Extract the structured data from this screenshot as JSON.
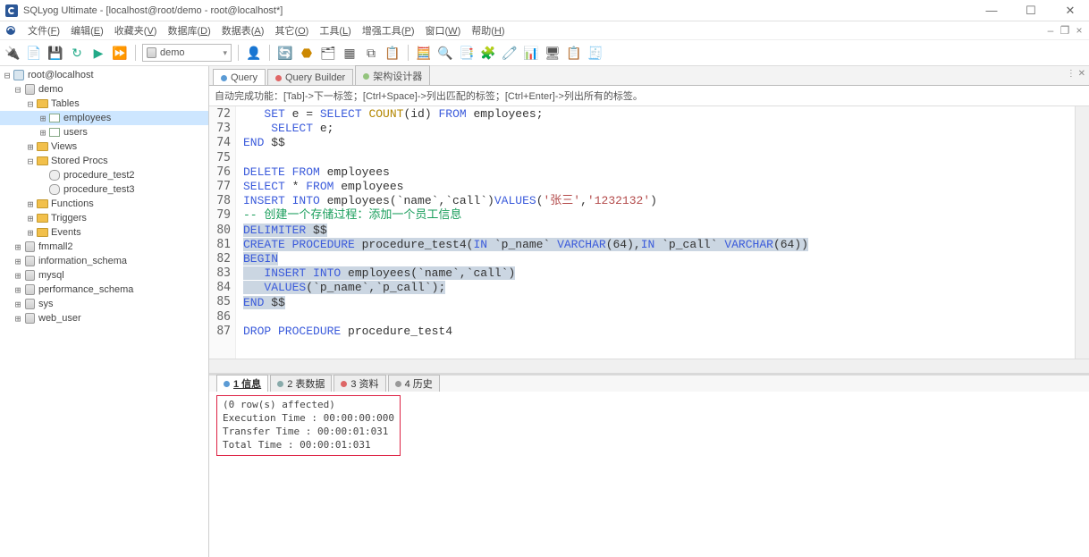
{
  "title": "SQLyog Ultimate - [localhost@root/demo - root@localhost*]",
  "menus": {
    "file": {
      "label": "文件",
      "key": "F"
    },
    "edit": {
      "label": "编辑",
      "key": "E"
    },
    "fav": {
      "label": "收藏夹",
      "key": "V"
    },
    "db": {
      "label": "数据库",
      "key": "D"
    },
    "table": {
      "label": "数据表",
      "key": "A"
    },
    "other": {
      "label": "其它",
      "key": "O"
    },
    "tools": {
      "label": "工具",
      "key": "L"
    },
    "ptools": {
      "label": "增强工具",
      "key": "P"
    },
    "window": {
      "label": "窗口",
      "key": "W"
    },
    "help": {
      "label": "帮助",
      "key": "H"
    }
  },
  "toolbar": {
    "db_selected": "demo"
  },
  "tree": {
    "root": "root@localhost",
    "db": "demo",
    "tables_label": "Tables",
    "tables": [
      "employees",
      "users"
    ],
    "views": "Views",
    "storedprocs_label": "Stored Procs",
    "storedprocs": [
      "procedure_test2",
      "procedure_test3"
    ],
    "functions": "Functions",
    "triggers": "Triggers",
    "events": "Events",
    "other_dbs": [
      "fmmall2",
      "information_schema",
      "mysql",
      "performance_schema",
      "sys",
      "web_user"
    ]
  },
  "query_tabs": {
    "query": "Query",
    "builder": "Query Builder",
    "schema": "架构设计器"
  },
  "hint": "自动完成功能：[Tab]->下一标签；[Ctrl+Space]->列出匹配的标签；[Ctrl+Enter]->列出所有的标签。",
  "editor": {
    "first_line": 72,
    "lines": [
      [
        [
          "kw",
          "   SET"
        ],
        [
          "pl",
          " e = "
        ],
        [
          "kw",
          "SELECT "
        ],
        [
          "func",
          "COUNT"
        ],
        [
          "pl",
          "(id) "
        ],
        [
          "kw",
          "FROM"
        ],
        [
          "pl",
          " employees;"
        ]
      ],
      [
        [
          "pl",
          "    "
        ],
        [
          "kw",
          "SELECT"
        ],
        [
          "pl",
          " e;"
        ]
      ],
      [
        [
          "kw",
          "END"
        ],
        [
          "pl",
          " $$"
        ]
      ],
      [
        [
          "pl",
          ""
        ]
      ],
      [
        [
          "kw",
          "DELETE FROM"
        ],
        [
          "pl",
          " employees"
        ]
      ],
      [
        [
          "kw",
          "SELECT"
        ],
        [
          "pl",
          " * "
        ],
        [
          "kw",
          "FROM"
        ],
        [
          "pl",
          " employees"
        ]
      ],
      [
        [
          "kw",
          "INSERT INTO"
        ],
        [
          "pl",
          " employees(`name`,`call`)"
        ],
        [
          "kw",
          "VALUES"
        ],
        [
          "pl",
          "("
        ],
        [
          "str",
          "'张三'"
        ],
        [
          "pl",
          ","
        ],
        [
          "str",
          "'1232132'"
        ],
        [
          "pl",
          ")"
        ]
      ],
      [
        [
          "cmt",
          "-- 创建一个存储过程：添加一个员工信息"
        ]
      ],
      [
        [
          "sel-kw",
          "DELIMITER"
        ],
        [
          "sel-pl",
          " $$"
        ]
      ],
      [
        [
          "sel-kw",
          "CREATE PROCEDURE"
        ],
        [
          "sel-pl",
          " procedure_test4("
        ],
        [
          "sel-kw",
          "IN"
        ],
        [
          "sel-pl",
          " `p_name` "
        ],
        [
          "sel-kw",
          "VARCHAR"
        ],
        [
          "sel-pl",
          "(64),"
        ],
        [
          "sel-kw",
          "IN"
        ],
        [
          "sel-pl",
          " `p_call` "
        ],
        [
          "sel-kw",
          "VARCHAR"
        ],
        [
          "sel-pl",
          "(64))"
        ]
      ],
      [
        [
          "sel-kw",
          "BEGIN"
        ]
      ],
      [
        [
          "sel-pl",
          "   "
        ],
        [
          "sel-kw",
          "INSERT INTO"
        ],
        [
          "sel-pl",
          " employees(`name`,`call`)"
        ]
      ],
      [
        [
          "sel-pl",
          "   "
        ],
        [
          "sel-kw",
          "VALUES"
        ],
        [
          "sel-pl",
          "(`p_name`,`p_call`);"
        ]
      ],
      [
        [
          "sel-kw",
          "END"
        ],
        [
          "sel-pl",
          " $$"
        ]
      ],
      [
        [
          "pl",
          ""
        ]
      ],
      [
        [
          "kw",
          "DROP PROCEDURE"
        ],
        [
          "pl",
          " procedure_test4"
        ]
      ]
    ]
  },
  "result_tabs": {
    "t1": "1 信息",
    "t2": "2 表数据",
    "t3": "3 资料",
    "t4": "4 历史"
  },
  "result": {
    "l1": "(0 row(s) affected)",
    "l2": "Execution Time : 00:00:00:000",
    "l3": "Transfer Time  : 00:00:01:031",
    "l4": "Total Time     : 00:00:01:031"
  }
}
